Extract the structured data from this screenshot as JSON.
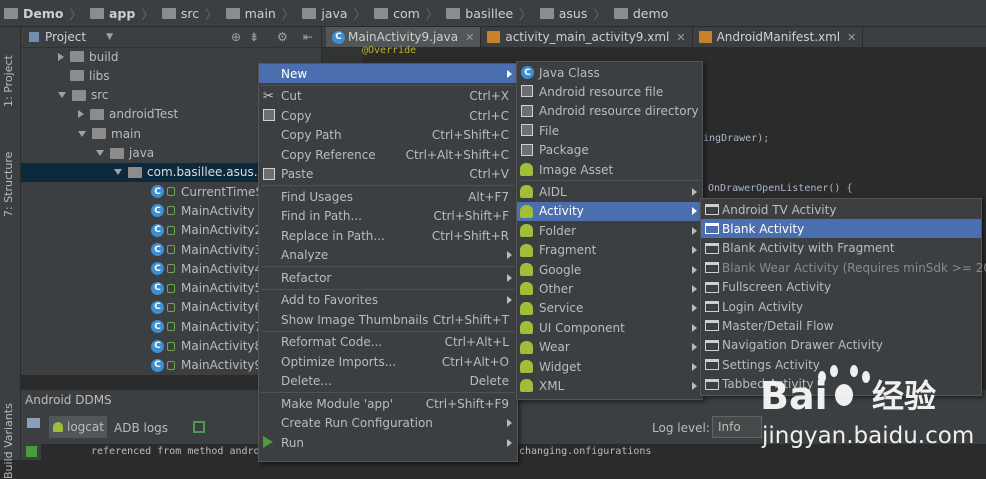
{
  "breadcrumb": [
    "Demo",
    "app",
    "src",
    "main",
    "java",
    "com",
    "basillee",
    "asus",
    "demo"
  ],
  "left_strip": {
    "project": "1: Project",
    "structure": "7: Structure",
    "variants": "Build Variants"
  },
  "project_panel": {
    "title": "Project",
    "tree": [
      {
        "label": "build",
        "type": "folder",
        "expanded": false
      },
      {
        "label": "libs",
        "type": "folder",
        "expanded": null
      },
      {
        "label": "src",
        "type": "folder",
        "expanded": true
      },
      {
        "label": "androidTest",
        "type": "folder",
        "expanded": false
      },
      {
        "label": "main",
        "type": "folder",
        "expanded": true
      },
      {
        "label": "java",
        "type": "folder",
        "expanded": true
      },
      {
        "label": "com.basillee.asus.de",
        "type": "package",
        "expanded": true,
        "selected": true
      },
      {
        "label": "CurrentTimeSe",
        "type": "class"
      },
      {
        "label": "MainActivity",
        "type": "class"
      },
      {
        "label": "MainActivity2",
        "type": "class"
      },
      {
        "label": "MainActivity3",
        "type": "class"
      },
      {
        "label": "MainActivity4",
        "type": "class"
      },
      {
        "label": "MainActivity5",
        "type": "class"
      },
      {
        "label": "MainActivity6",
        "type": "class"
      },
      {
        "label": "MainActivity7",
        "type": "class"
      },
      {
        "label": "MainActivity8",
        "type": "class"
      },
      {
        "label": "MainActivity9",
        "type": "class"
      }
    ]
  },
  "editor_tabs": [
    {
      "label": "MainActivity9.java",
      "icon": "java-class-icon",
      "active": true
    },
    {
      "label": "activity_main_activity9.xml",
      "icon": "xml-file-icon",
      "active": false
    },
    {
      "label": "AndroidManifest.xml",
      "icon": "xml-file-icon",
      "active": false
    }
  ],
  "code_snippets": {
    "override": "@Override",
    "drawer": "dingDrawer);",
    "listener": "OnDrawerOpenListener() {",
    "referenced": "referenced from method android",
    "changing": "changing.onfigurations"
  },
  "ddms": {
    "title": "Android DDMS",
    "tabs": [
      "logcat",
      "ADB logs"
    ],
    "log_level_label": "Log level:",
    "log_level_value": "Info"
  },
  "context_menu": [
    {
      "label": "New",
      "shortcut": "",
      "submenu": true,
      "selected": true
    },
    {
      "sep": true
    },
    {
      "label": "Cut",
      "shortcut": "Ctrl+X",
      "icon": "cut-icon"
    },
    {
      "label": "Copy",
      "shortcut": "Ctrl+C",
      "icon": "copy-icon"
    },
    {
      "label": "Copy Path",
      "shortcut": "Ctrl+Shift+C"
    },
    {
      "label": "Copy Reference",
      "shortcut": "Ctrl+Alt+Shift+C"
    },
    {
      "label": "Paste",
      "shortcut": "Ctrl+V",
      "icon": "paste-icon"
    },
    {
      "sep": true
    },
    {
      "label": "Find Usages",
      "shortcut": "Alt+F7"
    },
    {
      "label": "Find in Path...",
      "shortcut": "Ctrl+Shift+F"
    },
    {
      "label": "Replace in Path...",
      "shortcut": "Ctrl+Shift+R"
    },
    {
      "label": "Analyze",
      "shortcut": "",
      "submenu": true
    },
    {
      "sep": true
    },
    {
      "label": "Refactor",
      "shortcut": "",
      "submenu": true
    },
    {
      "sep": true
    },
    {
      "label": "Add to Favorites",
      "shortcut": "",
      "submenu": true
    },
    {
      "label": "Show Image Thumbnails",
      "shortcut": "Ctrl+Shift+T"
    },
    {
      "sep": true
    },
    {
      "label": "Reformat Code...",
      "shortcut": "Ctrl+Alt+L"
    },
    {
      "label": "Optimize Imports...",
      "shortcut": "Ctrl+Alt+O"
    },
    {
      "label": "Delete...",
      "shortcut": "Delete"
    },
    {
      "sep": true
    },
    {
      "label": "Make Module 'app'",
      "shortcut": "Ctrl+Shift+F9"
    },
    {
      "label": "Create Run Configuration",
      "shortcut": "",
      "submenu": true
    },
    {
      "label": "Run",
      "shortcut": "",
      "submenu": true,
      "icon": "run-icon"
    }
  ],
  "new_submenu": [
    {
      "label": "Java Class",
      "icon": "java-class-icon"
    },
    {
      "label": "Android resource file",
      "icon": "resource-file-icon"
    },
    {
      "label": "Android resource directory",
      "icon": "resource-dir-icon"
    },
    {
      "label": "File",
      "icon": "file-icon"
    },
    {
      "label": "Package",
      "icon": "package-icon"
    },
    {
      "label": "Image Asset",
      "icon": "android-icon"
    },
    {
      "sep": true
    },
    {
      "label": "AIDL",
      "icon": "android-icon",
      "submenu": true
    },
    {
      "label": "Activity",
      "icon": "android-icon",
      "submenu": true,
      "selected": true
    },
    {
      "label": "Folder",
      "icon": "android-icon",
      "submenu": true
    },
    {
      "label": "Fragment",
      "icon": "android-icon",
      "submenu": true
    },
    {
      "label": "Google",
      "icon": "android-icon",
      "submenu": true
    },
    {
      "label": "Other",
      "icon": "android-icon",
      "submenu": true
    },
    {
      "label": "Service",
      "icon": "android-icon",
      "submenu": true
    },
    {
      "label": "UI Component",
      "icon": "android-icon",
      "submenu": true
    },
    {
      "label": "Wear",
      "icon": "android-icon",
      "submenu": true
    },
    {
      "label": "Widget",
      "icon": "android-icon",
      "submenu": true
    },
    {
      "label": "XML",
      "icon": "android-icon",
      "submenu": true
    }
  ],
  "activity_submenu": [
    {
      "label": "Android TV Activity"
    },
    {
      "label": "Blank Activity",
      "selected": true
    },
    {
      "label": "Blank Activity with Fragment"
    },
    {
      "label": "Blank Wear Activity (Requires minSdk >= 20)",
      "disabled": true
    },
    {
      "label": "Fullscreen Activity"
    },
    {
      "label": "Login Activity"
    },
    {
      "label": "Master/Detail Flow"
    },
    {
      "label": "Navigation Drawer Activity"
    },
    {
      "label": "Settings Activity"
    },
    {
      "label": "Tabbed Activity"
    }
  ],
  "watermark": {
    "brand": "Bai",
    "cn": "经验",
    "url": "jingyan.baidu.com"
  },
  "colors": {
    "selection": "#4b6eaf",
    "activity_sel": "#4b6eaf",
    "android_green": "#9fbf3b",
    "java_blue": "#3d8fd1"
  }
}
